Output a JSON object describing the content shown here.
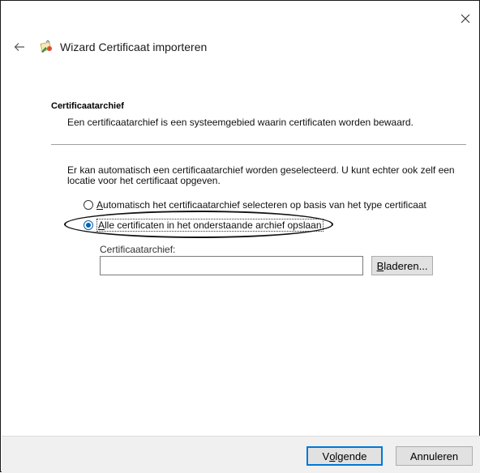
{
  "window": {
    "title": "Wizard Certificaat importeren",
    "close_icon": "close-icon",
    "back_icon": "back-arrow-icon",
    "title_icon": "certificate-icon"
  },
  "section": {
    "heading": "Certificaatarchief",
    "description": "Een certificaatarchief is een systeemgebied waarin certificaten worden bewaard."
  },
  "intro_text": "Er kan automatisch een certificaatarchief worden geselecteerd. U kunt echter ook zelf een locatie voor het certificaat opgeven.",
  "options": {
    "auto": {
      "accel": "A",
      "label_rest": "utomatisch het certificaatarchief selecteren op basis van het type certificaat",
      "checked": false
    },
    "manual": {
      "accel": "A",
      "label_rest": "lle certificaten in het onderstaande archief opslaan",
      "checked": true
    }
  },
  "store_field": {
    "label": "Certificaatarchief:",
    "value": ""
  },
  "buttons": {
    "browse_accel": "B",
    "browse_rest": "laderen...",
    "next_pre": "V",
    "next_accel": "o",
    "next_rest": "lgende",
    "cancel": "Annuleren"
  },
  "colors": {
    "accent": "#0078d7",
    "footer_bg": "#f0f0f0"
  }
}
